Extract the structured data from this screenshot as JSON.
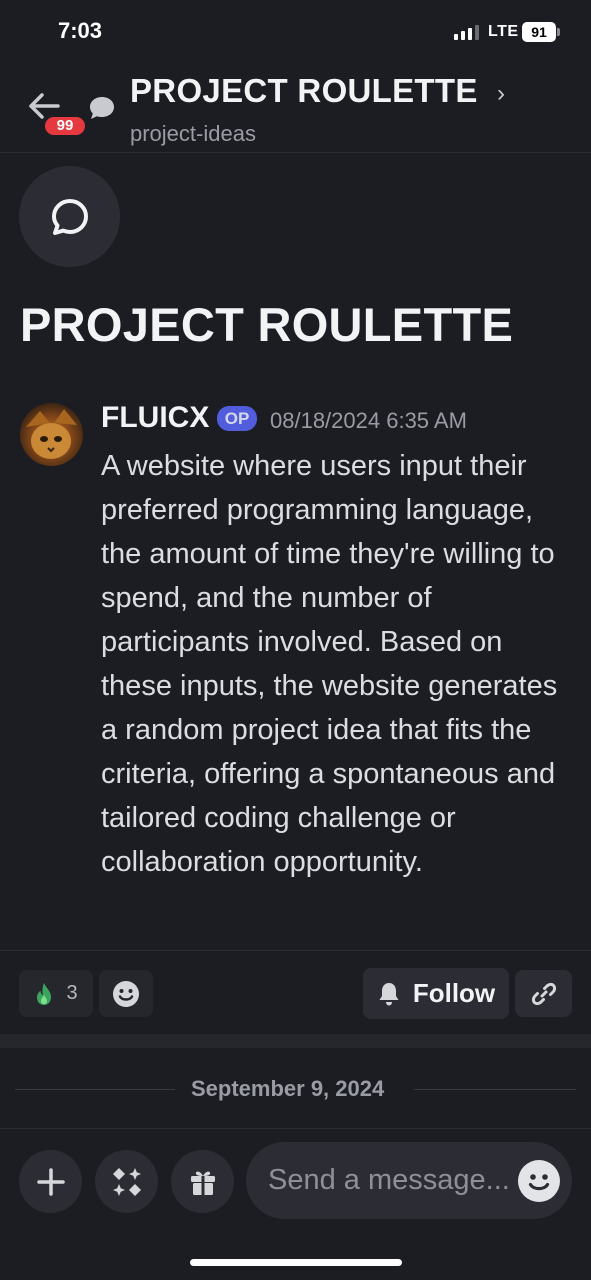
{
  "status_bar": {
    "time": "7:03",
    "network": "LTE",
    "battery": "91"
  },
  "header": {
    "title": "PROJECT ROULETTE",
    "chevron": "›",
    "subtitle": "project-ideas",
    "unread_badge": "99"
  },
  "thread": {
    "icon": "thread-bubble-icon",
    "title": "PROJECT ROULETTE"
  },
  "message": {
    "author": "FLUICX",
    "author_tag": "OP",
    "timestamp": "08/18/2024 6:35 AM",
    "text": "A website where users input their preferred programming language, the amount of time they're willing to spend, and the number of participants involved. Based on these inputs, the website generates a random project idea that fits the criteria, offering a spontaneous and tailored coding challenge or collaboration opportunity."
  },
  "reactions": [
    {
      "icon": "fire-icon",
      "count": "3"
    }
  ],
  "actions": {
    "follow_label": "Follow"
  },
  "date_separator": "September 9, 2024",
  "composer": {
    "placeholder": "Send a message..."
  },
  "colors": {
    "background": "#1c1d22",
    "surface": "#2c2d34",
    "badge_red": "#e5393f",
    "op_blurple": "#5865f2",
    "fire_green": "#3ba55d"
  }
}
